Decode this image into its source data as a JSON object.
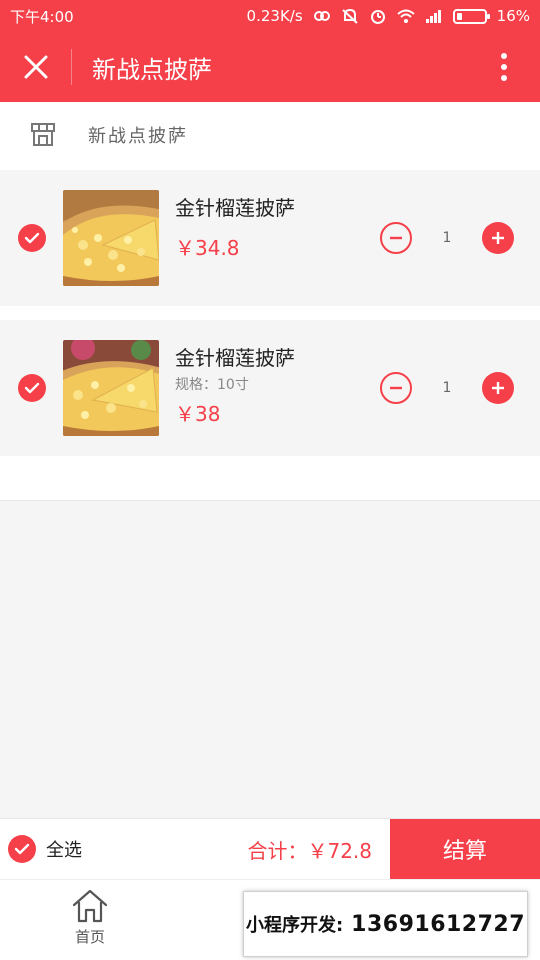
{
  "status_bar": {
    "time": "下午4:00",
    "speed": "0.23K/s",
    "battery": "16%"
  },
  "nav": {
    "title": "新战点披萨"
  },
  "store": {
    "name": "新战点披萨"
  },
  "cart": {
    "items": [
      {
        "name": "金针榴莲披萨",
        "spec": "",
        "price": "￥34.8",
        "qty": "1",
        "checked": true
      },
      {
        "name": "金针榴莲披萨",
        "spec": "规格：10寸",
        "price": "￥38",
        "qty": "1",
        "checked": true
      }
    ]
  },
  "checkout": {
    "select_all": "全选",
    "total": "合计：￥72.8",
    "button": "结算"
  },
  "tabs": {
    "home": "首页"
  },
  "promo": {
    "label": "小程序开发:",
    "phone": "13691612727"
  },
  "colors": {
    "accent": "#f5404a"
  }
}
